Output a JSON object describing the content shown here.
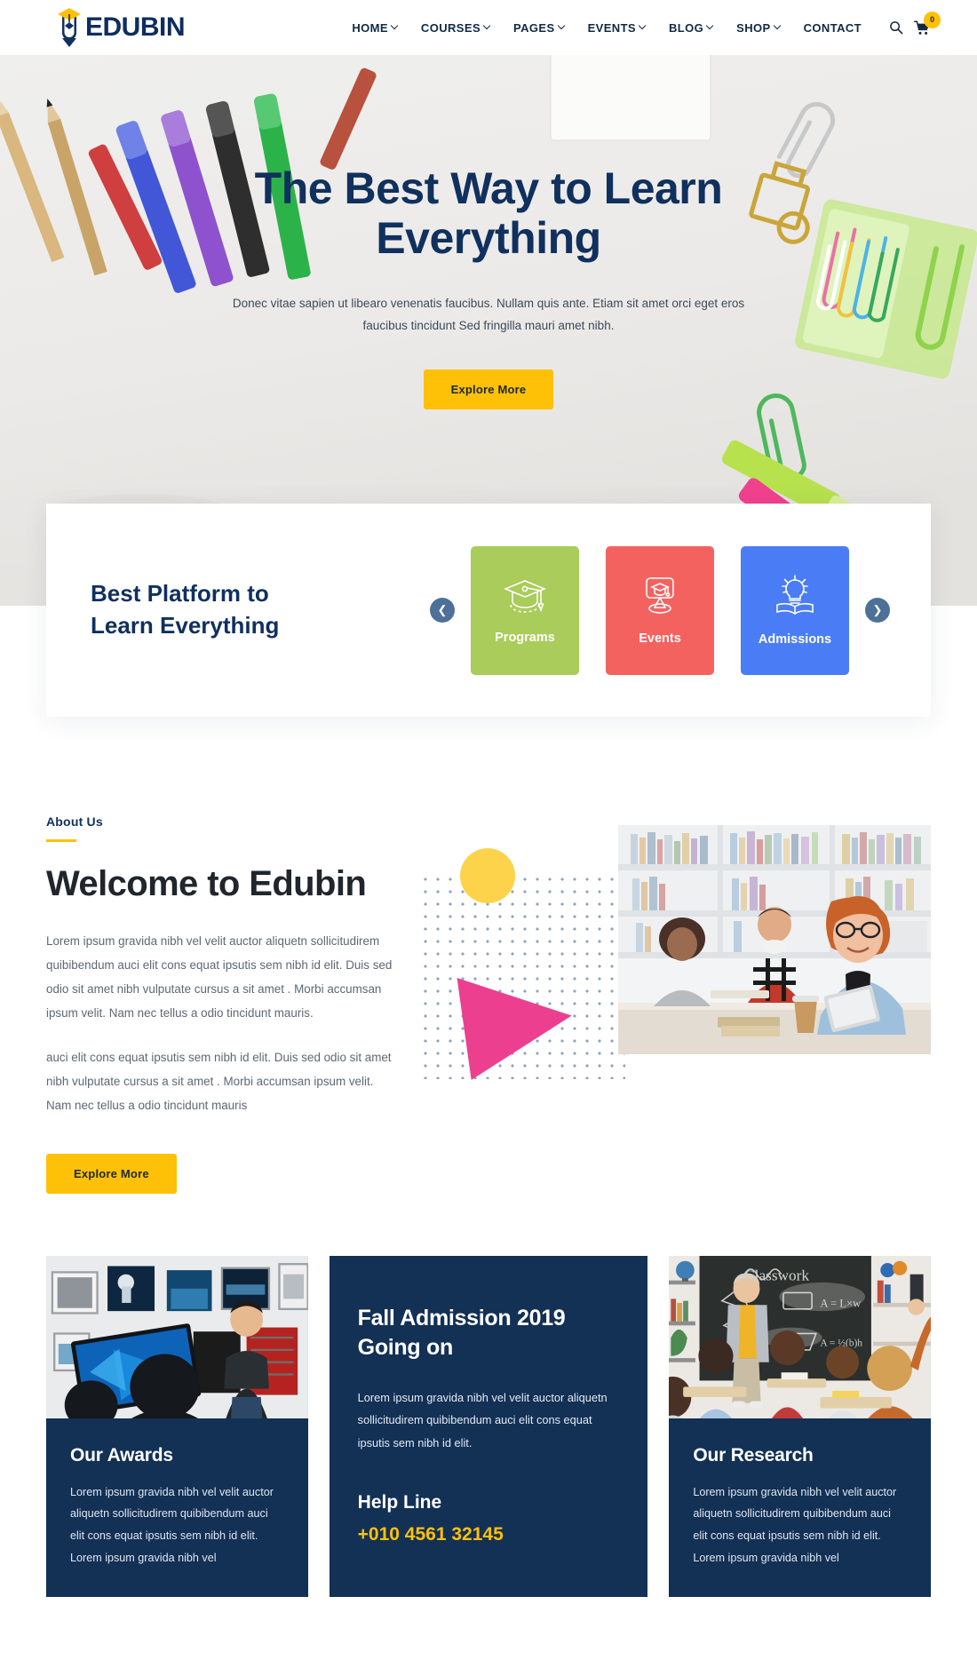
{
  "brand": {
    "name": "EDUBIN",
    "logo_icon": "graduation-shield-icon",
    "navy": "#10305e",
    "yellow": "#ffc107"
  },
  "header": {
    "nav": [
      {
        "label": "HOME",
        "has_dropdown": true
      },
      {
        "label": "COURSES",
        "has_dropdown": true
      },
      {
        "label": "PAGES",
        "has_dropdown": true
      },
      {
        "label": "EVENTS",
        "has_dropdown": true
      },
      {
        "label": "BLOG",
        "has_dropdown": true
      },
      {
        "label": "SHOP",
        "has_dropdown": true
      },
      {
        "label": "CONTACT",
        "has_dropdown": false
      }
    ],
    "search_icon": "search-icon",
    "cart_icon": "cart-icon",
    "cart_count": "0"
  },
  "hero": {
    "title_line1": "The Best Way to Learn",
    "title_line2": "Everything",
    "subtitle": "Donec vitae sapien ut libearo venenatis faucibus. Nullam quis ante. Etiam sit amet orci eget eros faucibus tincidunt Sed fringilla mauri amet nibh.",
    "cta": "Explore More"
  },
  "platform": {
    "title": "Best Platform to Learn Everything",
    "prev_icon": "chevron-left-icon",
    "next_icon": "chevron-right-icon",
    "cards": [
      {
        "label": "Programs",
        "icon": "graduation-cap-icon",
        "color": "#a9cc5a"
      },
      {
        "label": "Events",
        "icon": "event-pin-icon",
        "color": "#f4625f"
      },
      {
        "label": "Admissions",
        "icon": "lightbulb-book-icon",
        "color": "#4a7df5"
      }
    ]
  },
  "about": {
    "eyebrow": "About Us",
    "heading": "Welcome to Edubin",
    "paragraph1": "Lorem ipsum gravida nibh vel velit auctor aliquetn sollicitudirem quibibendum auci elit cons equat ipsutis sem nibh id elit. Duis sed odio sit amet nibh vulputate cursus a sit amet . Morbi accumsan ipsum velit. Nam nec tellus a odio tincidunt mauris.",
    "paragraph2": "auci elit cons equat ipsutis sem nibh id elit. Duis sed odio sit amet nibh vulputate cursus a sit amet . Morbi accumsan ipsum velit. Nam nec tellus a odio tincidunt mauris",
    "cta": "Explore More",
    "photo_alt": "students-studying-in-library"
  },
  "bottom": {
    "left": {
      "heading": "Our Awards",
      "text": "Lorem ipsum gravida nibh vel velit auctor aliquetn sollicitudirem quibibendum auci elit cons equat ipsutis sem nibh id elit. Lorem ipsum gravida nibh vel",
      "photo_alt": "gallery-presentation"
    },
    "middle": {
      "heading": "Fall Admission 2019 Going on",
      "text": "Lorem ipsum gravida nibh vel velit auctor aliquetn sollicitudirem quibibendum auci elit cons equat ipsutis sem nibh id elit.",
      "help_label": "Help Line",
      "phone": "+010 4561 32145"
    },
    "right": {
      "heading": "Our Research",
      "text": "Lorem ipsum gravida nibh vel velit auctor aliquetn sollicitudirem quibibendum auci elit cons equat ipsutis sem nibh id elit. Lorem ipsum gravida nibh vel",
      "photo_alt": "classroom-teacher-blackboard"
    }
  }
}
